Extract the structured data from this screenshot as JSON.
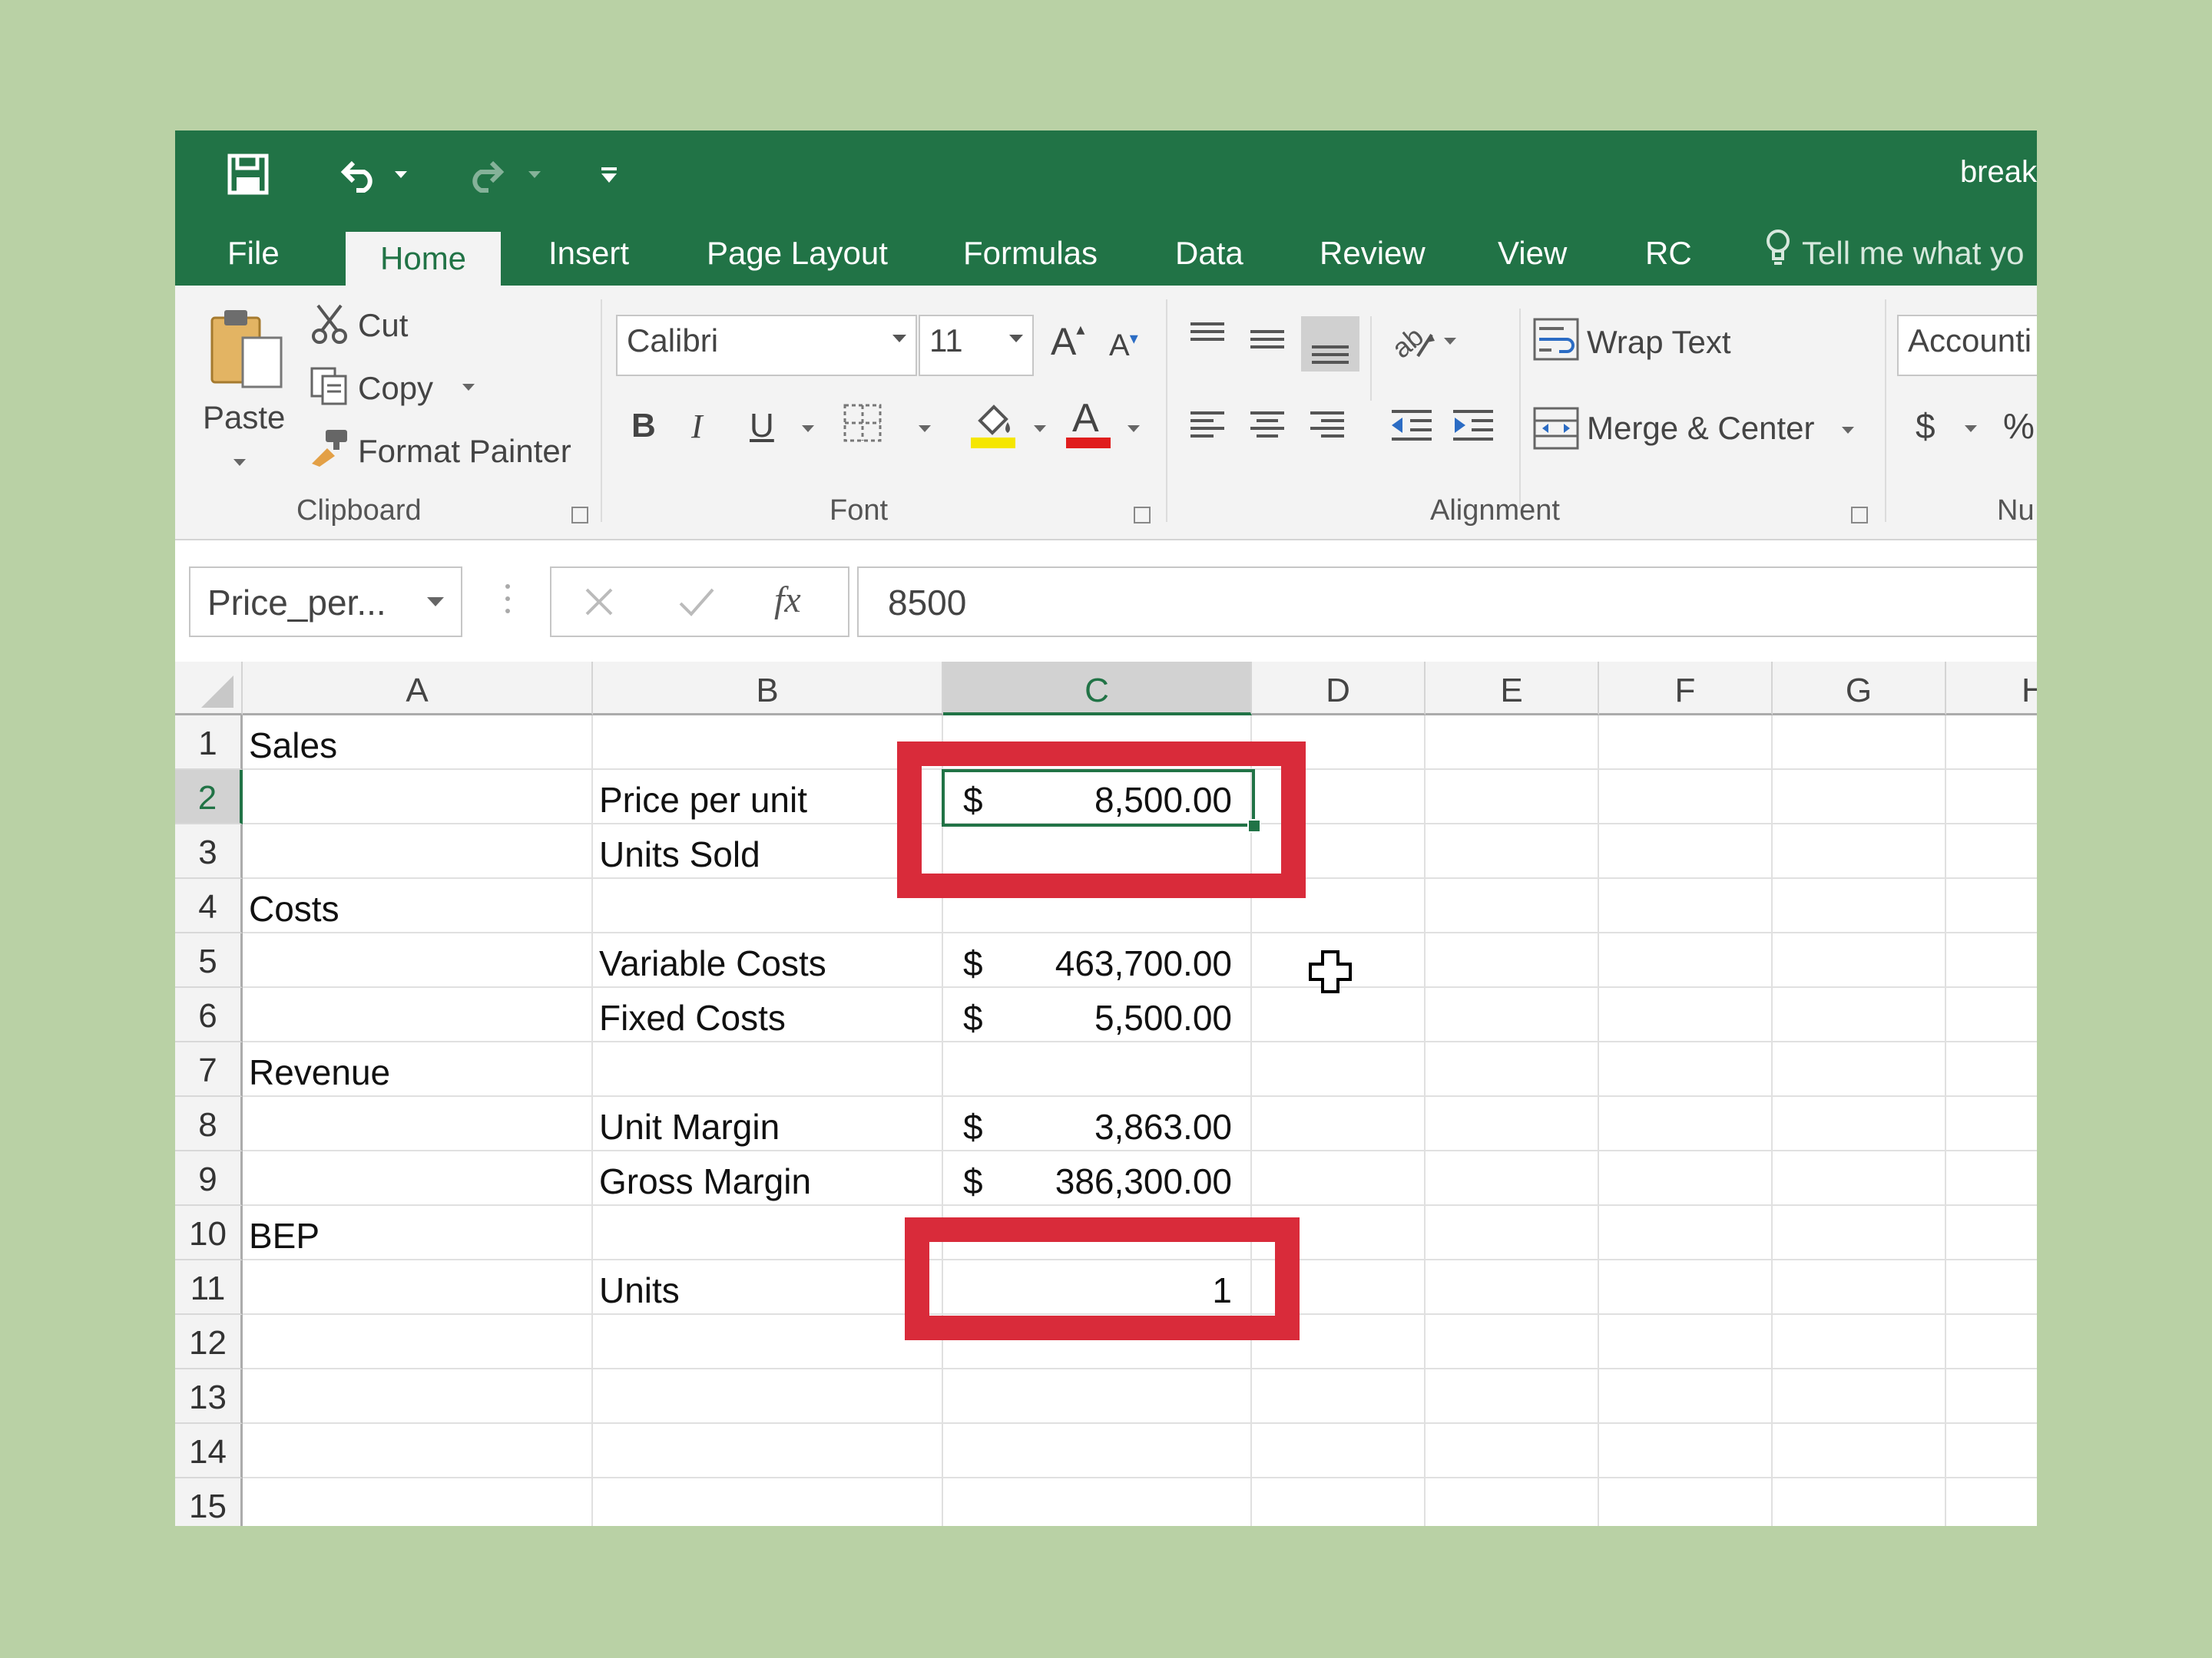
{
  "window": {
    "doc_title": "break"
  },
  "tabs": [
    "File",
    "Home",
    "Insert",
    "Page Layout",
    "Formulas",
    "Data",
    "Review",
    "View",
    "RC"
  ],
  "tell_me": "Tell me what yo",
  "ribbon": {
    "clipboard": {
      "paste": "Paste",
      "cut": "Cut",
      "copy": "Copy",
      "format_painter": "Format Painter",
      "group_label": "Clipboard"
    },
    "font": {
      "name": "Calibri",
      "size": "11",
      "bold": "B",
      "italic": "I",
      "underline": "U",
      "group_label": "Font",
      "fill_color": "#f5e600",
      "font_color": "#e01e1e"
    },
    "alignment": {
      "wrap_text": "Wrap Text",
      "merge_center": "Merge & Center",
      "group_label": "Alignment"
    },
    "number": {
      "format": "Accounti",
      "currency": "$",
      "percent": "%",
      "group_label": "Nu"
    }
  },
  "formula_bar": {
    "name_box": "Price_per...",
    "content": "8500"
  },
  "columns": [
    "A",
    "B",
    "C",
    "D",
    "E",
    "F",
    "G",
    "H"
  ],
  "rows": [
    {
      "n": "1",
      "a": "Sales",
      "b": "",
      "cur": "",
      "c": ""
    },
    {
      "n": "2",
      "a": "",
      "b": "Price per unit",
      "cur": "$",
      "c": "8,500.00"
    },
    {
      "n": "3",
      "a": "",
      "b": "Units Sold",
      "cur": "",
      "c": ""
    },
    {
      "n": "4",
      "a": "Costs",
      "b": "",
      "cur": "",
      "c": ""
    },
    {
      "n": "5",
      "a": "",
      "b": "Variable Costs",
      "cur": "$",
      "c": "463,700.00"
    },
    {
      "n": "6",
      "a": "",
      "b": "Fixed Costs",
      "cur": "$",
      "c": "5,500.00"
    },
    {
      "n": "7",
      "a": "Revenue",
      "b": "",
      "cur": "",
      "c": ""
    },
    {
      "n": "8",
      "a": "",
      "b": "Unit Margin",
      "cur": "$",
      "c": "3,863.00"
    },
    {
      "n": "9",
      "a": "",
      "b": "Gross Margin",
      "cur": "$",
      "c": "386,300.00"
    },
    {
      "n": "10",
      "a": "BEP",
      "b": "",
      "cur": "",
      "c": ""
    },
    {
      "n": "11",
      "a": "",
      "b": "Units",
      "cur": "",
      "c": "1"
    },
    {
      "n": "12",
      "a": "",
      "b": "",
      "cur": "",
      "c": ""
    },
    {
      "n": "13",
      "a": "",
      "b": "",
      "cur": "",
      "c": ""
    },
    {
      "n": "14",
      "a": "",
      "b": "",
      "cur": "",
      "c": ""
    },
    {
      "n": "15",
      "a": "",
      "b": "",
      "cur": "",
      "c": ""
    }
  ],
  "selection": {
    "cell": "C2"
  },
  "highlight_color": "#d92b3a"
}
